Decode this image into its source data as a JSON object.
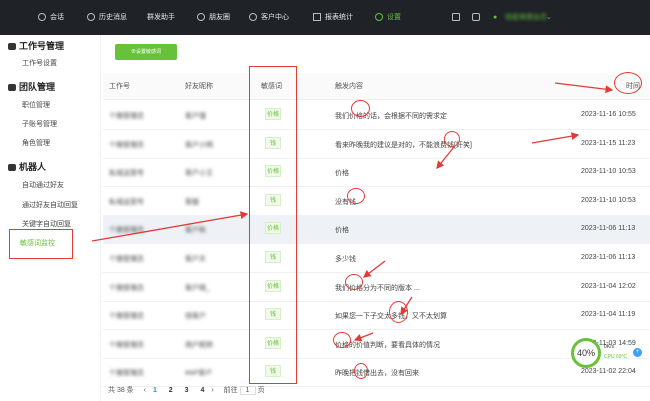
{
  "topnav": {
    "items": [
      {
        "label": "会话",
        "icon": "chat-icon"
      },
      {
        "label": "历史消息",
        "icon": "clock-icon"
      },
      {
        "label": "群发助手",
        "icon": "send-icon"
      },
      {
        "label": "朋友圈",
        "icon": "camera-icon"
      },
      {
        "label": "客户中心",
        "icon": "user-icon"
      },
      {
        "label": "报表统计",
        "icon": "bar-chart-icon"
      },
      {
        "label": "设置",
        "icon": "gear-icon"
      }
    ],
    "user_name": "钱星商德会员"
  },
  "sidebar": {
    "sections": [
      {
        "title": "工作号管理",
        "items": [
          "工作号设置"
        ]
      },
      {
        "title": "团队管理",
        "items": [
          "职位管理",
          "子账号管理",
          "角色管理"
        ]
      },
      {
        "title": "机器人",
        "items": [
          "自动通过好友",
          "通过好友自动回复",
          "关键字自动回复",
          "敏感词监控"
        ]
      }
    ],
    "active": "敏感词监控"
  },
  "main": {
    "add_button": "设置敏感词",
    "columns": [
      "工作号",
      "好友昵称",
      "敏感词",
      "触发内容",
      "时间"
    ],
    "rows": [
      {
        "account": "个微管理员",
        "friend": "客户强",
        "word": "价格",
        "content": "我们价格的话，会根据不同的需求定",
        "time": "2023-11-16 10:55"
      },
      {
        "account": "个微管理员",
        "friend": "客户小明",
        "word": "钱",
        "content": "看来昨晚我的建议是对的，不能浪费钱[奸笑]",
        "time": "2023-11-15 11:23"
      },
      {
        "account": "私域运营号",
        "friend": "客户小王",
        "word": "价格",
        "content": "价格",
        "time": "2023-11-10 10:53"
      },
      {
        "account": "私域运营号",
        "friend": "客服",
        "word": "钱",
        "content": "没有钱",
        "time": "2023-11-10 10:53"
      },
      {
        "account": "个微管理员",
        "friend": "客户秋",
        "word": "价格",
        "content": "价格",
        "time": "2023-11-06 11:13"
      },
      {
        "account": "个微管理员",
        "friend": "客户天",
        "word": "钱",
        "content": "多少钱",
        "time": "2023-11-06 11:13"
      },
      {
        "account": "个微管理员",
        "friend": "客户晴_",
        "word": "价格",
        "content": "我们价格分为不同的版本 ...",
        "time": "2023-11-04 12:02"
      },
      {
        "account": "个微管理员",
        "friend": "钱客户",
        "word": "钱",
        "content": "如果您一下子交太多钱，又不太划算",
        "time": "2023-11-04 11:19"
      },
      {
        "account": "个微管理员",
        "friend": "用户昵称",
        "word": "价格",
        "content": "价格的价值判断，要看具体的情况",
        "time": "2023-11-03 14:59"
      },
      {
        "account": "个微管理员",
        "friend": "#AP客户",
        "word": "钱",
        "content": "昨晚把钱借出去，没有回来",
        "time": "2023-11-02 22:04"
      }
    ],
    "pager": {
      "total": "共 38 条",
      "pages": [
        "1",
        "2",
        "3",
        "4"
      ],
      "goto": "前往",
      "goto_value": "1",
      "page_unit": "页"
    }
  },
  "widget": {
    "percent": "40%",
    "net": "0K/s",
    "cpu": "CPU 69°C"
  },
  "colors": {
    "accent": "#67c23a",
    "annotation": "#e53935",
    "topbar": "#1f2227"
  }
}
